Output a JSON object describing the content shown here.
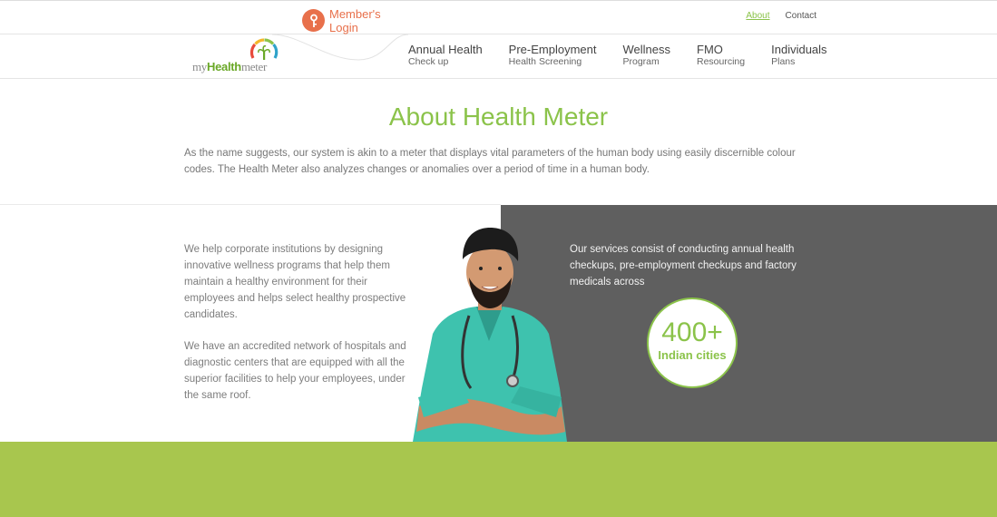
{
  "header": {
    "login": {
      "line1": "Member's",
      "line2": "Login",
      "icon": "key-icon"
    },
    "toplinks": [
      {
        "label": "About",
        "active": true
      },
      {
        "label": "Contact",
        "active": false
      }
    ],
    "logo": {
      "my": "my",
      "health": "Health",
      "meter": "meter"
    },
    "nav": [
      {
        "title": "Annual Health",
        "sub": "Check up"
      },
      {
        "title": "Pre-Employment",
        "sub": "Health Screening"
      },
      {
        "title": "Wellness",
        "sub": "Program"
      },
      {
        "title": "FMO",
        "sub": "Resourcing"
      },
      {
        "title": "Individuals",
        "sub": "Plans"
      }
    ]
  },
  "about": {
    "title": "About Health Meter",
    "description": "As the name suggests, our system is akin to a meter that displays vital parameters of the human body using easily discernible colour codes. The Health Meter also analyzes changes or anomalies over a period of time in a human body."
  },
  "features": {
    "left_p1": "We help corporate institutions by designing innovative wellness programs that help them maintain a healthy environment for their employees and helps select healthy prospective candidates.",
    "left_p2": "We have an accredited network of hospitals and diagnostic centers that are equipped with all the superior facilities to help your employees, under the same roof.",
    "right_text": "Our services consist of conducting annual health checkups, pre-employment checkups and factory medicals across",
    "badge_number": "400+",
    "badge_label": "Indian cities"
  },
  "colors": {
    "accent_green": "#8bc34a",
    "login_orange": "#e8704b",
    "panel_gray": "#5f5f5f",
    "band_green": "#a8c64e"
  }
}
